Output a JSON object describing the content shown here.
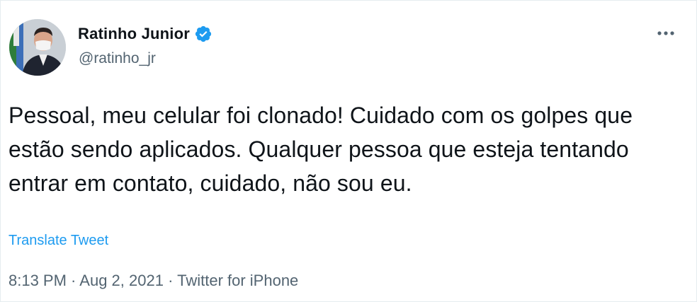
{
  "tweet": {
    "display_name": "Ratinho Junior",
    "handle": "@ratinho_jr",
    "verified": true,
    "text": "Pessoal, meu celular foi clonado! Cuidado com os golpes que estão sendo aplicados. Qualquer pessoa que esteja tentando entrar em contato, cuidado, não sou eu.",
    "translate_label": "Translate Tweet",
    "time": "8:13 PM",
    "separator": " · ",
    "date": "Aug 2, 2021",
    "source": "Twitter for iPhone"
  },
  "icons": {
    "verified": "verified-badge-icon",
    "more": "more-options-icon"
  },
  "colors": {
    "accent": "#1d9bf0",
    "secondary_text": "#536471",
    "primary_text": "#0f1419"
  }
}
